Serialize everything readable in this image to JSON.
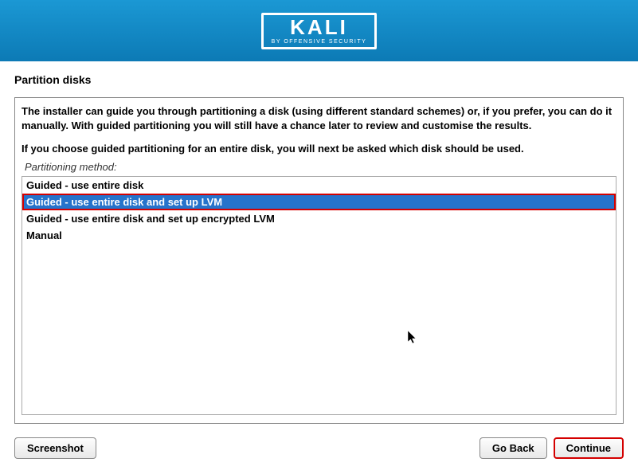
{
  "header": {
    "logo_main": "KALI",
    "logo_sub": "BY OFFENSIVE SECURITY"
  },
  "page_title": "Partition disks",
  "instruction_1": "The installer can guide you through partitioning a disk (using different standard schemes) or, if you prefer, you can do it manually. With guided partitioning you will still have a chance later to review and customise the results.",
  "instruction_2": "If you choose guided partitioning for an entire disk, you will next be asked which disk should be used.",
  "method_label": "Partitioning method:",
  "options": [
    {
      "label": "Guided - use entire disk",
      "selected": false
    },
    {
      "label": "Guided - use entire disk and set up LVM",
      "selected": true
    },
    {
      "label": "Guided - use entire disk and set up encrypted LVM",
      "selected": false
    },
    {
      "label": "Manual",
      "selected": false
    }
  ],
  "buttons": {
    "screenshot": "Screenshot",
    "go_back": "Go Back",
    "continue": "Continue"
  }
}
